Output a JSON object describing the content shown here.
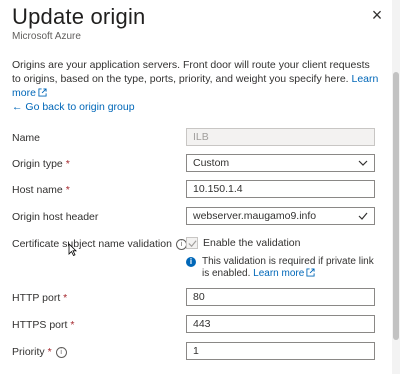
{
  "header": {
    "title": "Update origin",
    "subtitle": "Microsoft Azure",
    "close_glyph": "×"
  },
  "intro": {
    "text": "Origins are your application servers. Front door will route your client requests to origins, based on the type, ports, priority, and weight you specify here.",
    "link": "Learn more"
  },
  "back_link": "Go back to origin group",
  "form": {
    "name": {
      "label": "Name",
      "value": "ILB"
    },
    "origin_type": {
      "label": "Origin type",
      "required": "*",
      "value": "Custom"
    },
    "host_name": {
      "label": "Host name",
      "required": "*",
      "value": "10.150.1.4"
    },
    "origin_host_header": {
      "label": "Origin host header",
      "value": "webserver.maugamo9.info"
    },
    "cert_validation": {
      "label": "Certificate subject name validation",
      "checkbox_label": "Enable the validation",
      "checked": true,
      "note": "This validation is required if private link is enabled.",
      "note_link": "Learn more"
    },
    "http_port": {
      "label": "HTTP port",
      "required": "*",
      "value": "80"
    },
    "https_port": {
      "label": "HTTPS port",
      "required": "*",
      "value": "443"
    },
    "priority": {
      "label": "Priority",
      "required": "*",
      "value": "1"
    }
  },
  "icons": {
    "close": "close-icon",
    "back": "arrow-left-icon",
    "external": "external-link-icon",
    "info": "info-icon",
    "chevron": "chevron-down-icon",
    "valid": "checkmark-icon"
  },
  "colors": {
    "link": "#0067b8",
    "required": "#a4262c",
    "info_badge": "#0067b8"
  }
}
